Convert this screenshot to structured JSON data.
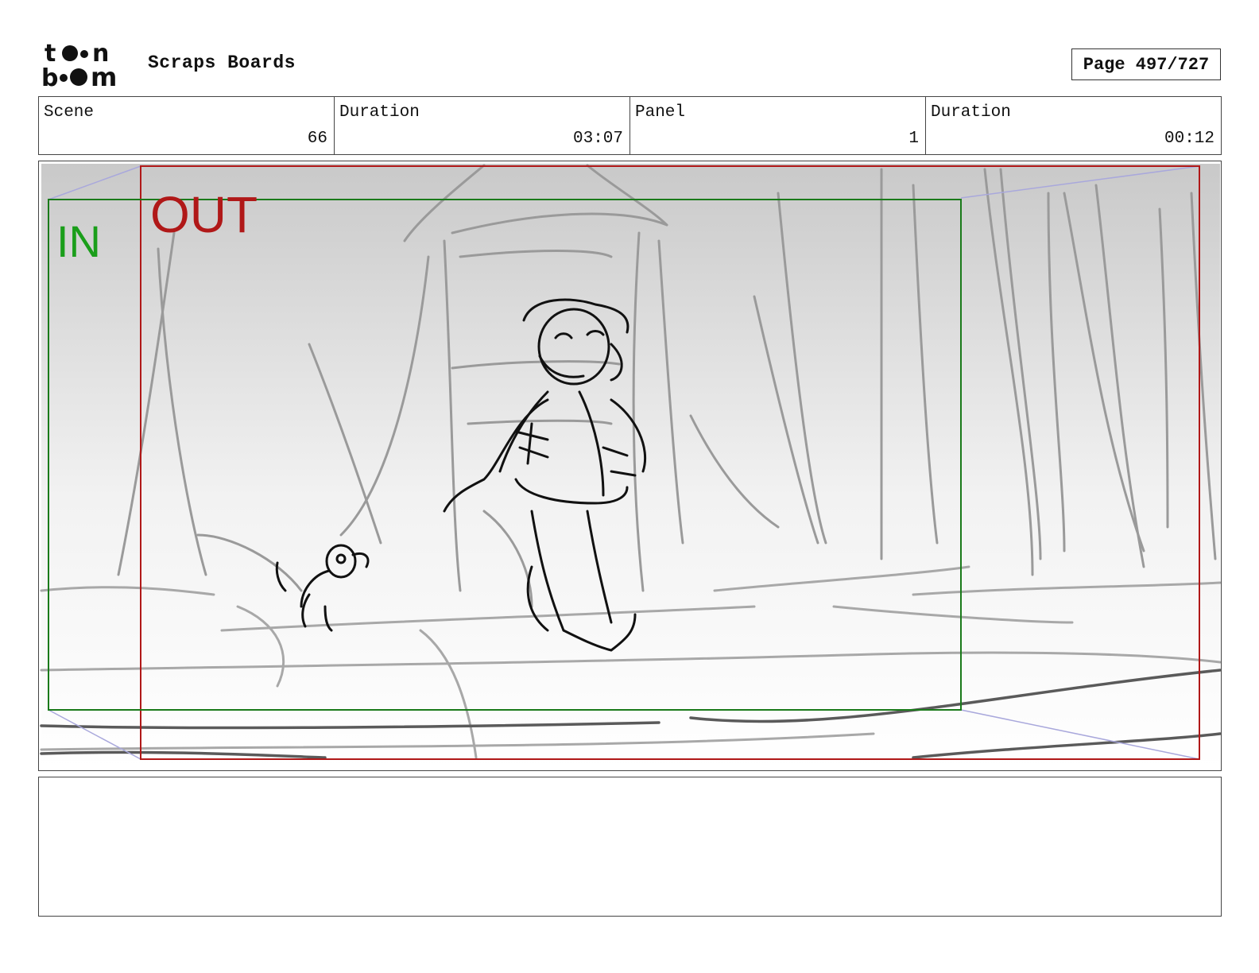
{
  "header": {
    "logo_top": "to•n",
    "logo_bottom": "b••m",
    "project_title": "Scraps Boards",
    "page_label": "Page 497/727"
  },
  "info": {
    "scene_label": "Scene",
    "scene_value": "66",
    "scene_duration_label": "Duration",
    "scene_duration_value": "03:07",
    "panel_label": "Panel",
    "panel_value": "1",
    "panel_duration_label": "Duration",
    "panel_duration_value": "00:12"
  },
  "panel": {
    "in_label": "IN",
    "out_label": "OUT",
    "in_color": "#1a9e1a",
    "out_color": "#b01818"
  },
  "notes": {
    "text": ""
  }
}
